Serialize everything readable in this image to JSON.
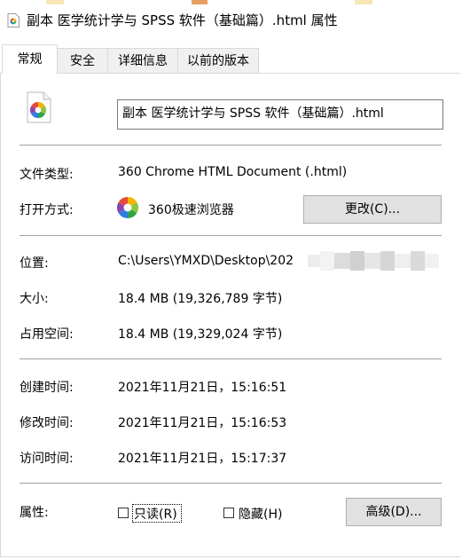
{
  "window": {
    "title": "副本 医学统计学与 SPSS 软件（基础篇）.html 属性"
  },
  "tabs": [
    {
      "label": "常规"
    },
    {
      "label": "安全"
    },
    {
      "label": "详细信息"
    },
    {
      "label": "以前的版本"
    }
  ],
  "general": {
    "file_name": "副本 医学统计学与 SPSS 软件（基础篇）.html",
    "file_type_label": "文件类型:",
    "file_type_value": "360 Chrome HTML Document (.html)",
    "open_with_label": "打开方式:",
    "open_with_value": "360极速浏览器",
    "change_button": "更改(C)...",
    "location_label": "位置:",
    "location_value": "C:\\Users\\YMXD\\Desktop\\202",
    "size_label": "大小:",
    "size_value": "18.4 MB (19,326,789 字节)",
    "size_on_disk_label": "占用空间:",
    "size_on_disk_value": "18.4 MB (19,329,024 字节)",
    "created_label": "创建时间:",
    "created_value": "2021年11月21日，15:16:51",
    "modified_label": "修改时间:",
    "modified_value": "2021年11月21日，15:16:53",
    "accessed_label": "访问时间:",
    "accessed_value": "2021年11月21日，15:17:37",
    "attributes_label": "属性:",
    "readonly_label": "只读(R)",
    "readonly_checked": false,
    "hidden_label": "隐藏(H)",
    "hidden_checked": false,
    "advanced_button": "高级(D)..."
  },
  "icons": {
    "title": "html-file-icon",
    "file": "html-file-icon",
    "app": "360-browser-icon"
  }
}
